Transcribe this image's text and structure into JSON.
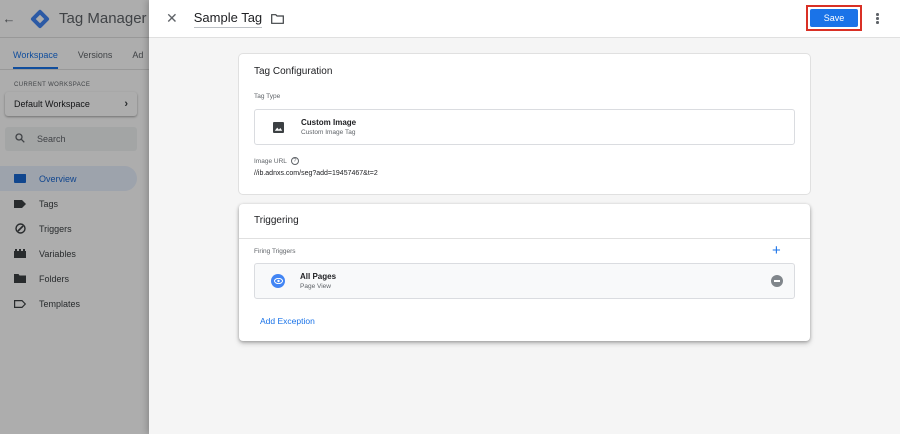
{
  "app": {
    "title": "Tag Manager",
    "tabs": [
      "Workspace",
      "Versions",
      "Ad"
    ],
    "current_workspace_label": "CURRENT WORKSPACE",
    "workspace_name": "Default Workspace",
    "search_placeholder": "Search",
    "nav": [
      {
        "label": "Overview",
        "icon": "overview-icon",
        "active": true
      },
      {
        "label": "Tags",
        "icon": "tag-icon"
      },
      {
        "label": "Triggers",
        "icon": "trigger-icon"
      },
      {
        "label": "Variables",
        "icon": "variables-icon"
      },
      {
        "label": "Folders",
        "icon": "folder-icon"
      },
      {
        "label": "Templates",
        "icon": "template-icon"
      }
    ]
  },
  "sheet": {
    "tag_name": "Sample Tag",
    "save_label": "Save",
    "config": {
      "title": "Tag Configuration",
      "tag_type_label": "Tag Type",
      "type_name": "Custom Image",
      "type_sub": "Custom Image Tag",
      "image_url_label": "Image URL",
      "image_url_value": "//ib.adnxs.com/seg?add=19457467&t=2"
    },
    "triggering": {
      "title": "Triggering",
      "firing_label": "Firing Triggers",
      "trigger_name": "All Pages",
      "trigger_type": "Page View",
      "add_exception_label": "Add Exception"
    }
  },
  "colors": {
    "accent": "#1a73e8",
    "highlight_border": "#d93025"
  }
}
